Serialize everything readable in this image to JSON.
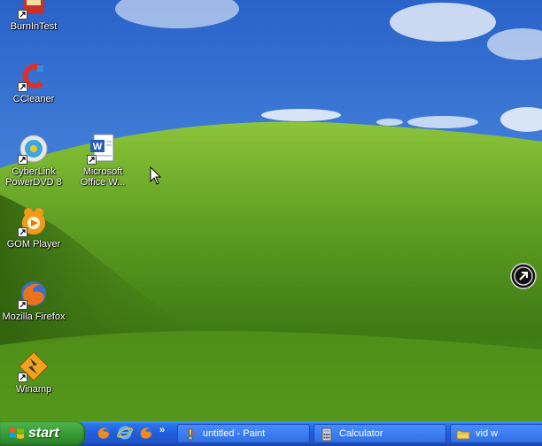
{
  "desktop": {
    "icons": [
      {
        "label": "BurnInTest",
        "icon": "burnintest-icon"
      },
      {
        "label": "CCleaner",
        "icon": "ccleaner-icon"
      },
      {
        "label": "CyberLink PowerDVD 8",
        "line1": "CyberLink",
        "line2": "PowerDVD 8",
        "icon": "powerdvd-icon"
      },
      {
        "label": "Microsoft Office W...",
        "line1": "Microsoft",
        "line2": "Office W...",
        "icon": "word-icon"
      },
      {
        "label": "GOM Player",
        "icon": "gom-player-icon"
      },
      {
        "label": "Mozilla Firefox",
        "icon": "firefox-icon"
      },
      {
        "label": "Winamp",
        "icon": "winamp-icon"
      }
    ]
  },
  "taskbar": {
    "start_label": "start",
    "quick_launch": [
      "firefox-icon",
      "internet-explorer-icon",
      "firefox-icon"
    ],
    "overflow": "»",
    "tasks": [
      {
        "label": "untitled - Paint",
        "icon": "paint-icon"
      },
      {
        "label": "Calculator",
        "icon": "calculator-icon"
      },
      {
        "label": "vid w",
        "icon": "folder-icon"
      }
    ]
  },
  "colors": {
    "taskbar": "#245edb",
    "start_button": "#3da23a",
    "sky": "#3b78d8",
    "hill": "#5fa52a"
  }
}
